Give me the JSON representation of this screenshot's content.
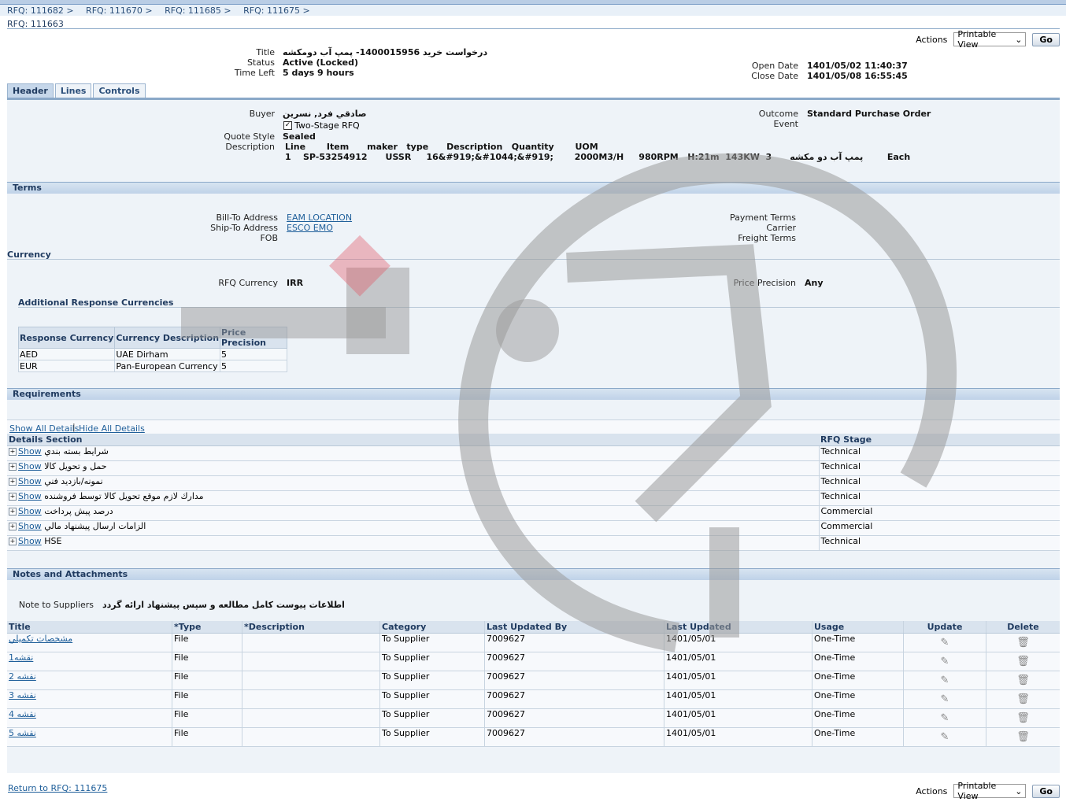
{
  "breadcrumbs": [
    "RFQ: 111682",
    "RFQ: 111670",
    "RFQ: 111685",
    "RFQ: 111675"
  ],
  "page_title": "RFQ: 111663",
  "actions": {
    "label": "Actions",
    "selected": "Printable View",
    "go": "Go"
  },
  "summary": {
    "title_label": "Title",
    "title_value": "درخواست خريد 1400015956- پمپ آب دومكشه",
    "status_label": "Status",
    "status_value": "Active (Locked)",
    "time_left_label": "Time Left",
    "time_left_value": "5 days 9 hours",
    "open_date_label": "Open Date",
    "open_date_value": "1401/05/02 11:40:37",
    "close_date_label": "Close Date",
    "close_date_value": "1401/05/08 16:55:45"
  },
  "tabs": [
    "Header",
    "Lines",
    "Controls"
  ],
  "header": {
    "buyer_label": "Buyer",
    "buyer_value": "صادقي فرد, نسرين",
    "two_stage_label": "Two-Stage RFQ",
    "quote_style_label": "Quote Style",
    "quote_style_value": "Sealed",
    "description_label": "Description",
    "desc_line1": "Line       Item      maker   type      Description   Quantity       UOM",
    "desc_line2": "1    SP-53254912      USSR     16&#919;&#1044;&#919;       2000M3/H     980RPM   H:21m  143KW  3      پمپ آب دو مكشه        Each",
    "outcome_label": "Outcome",
    "outcome_value": "Standard Purchase Order",
    "event_label": "Event"
  },
  "terms": {
    "section": "Terms",
    "bill_to_label": "Bill-To Address",
    "bill_to_value": "EAM LOCATION",
    "ship_to_label": "Ship-To Address",
    "ship_to_value": "ESCO EMO",
    "fob_label": "FOB",
    "payment_terms_label": "Payment Terms",
    "carrier_label": "Carrier",
    "freight_terms_label": "Freight Terms"
  },
  "currency": {
    "section": "Currency",
    "rfq_currency_label": "RFQ Currency",
    "rfq_currency_value": "IRR",
    "price_precision_label": "Price Precision",
    "price_precision_value": "Any",
    "additional_heading": "Additional Response Currencies",
    "columns": [
      "Response Currency",
      "Currency Description",
      "Price Precision"
    ],
    "rows": [
      [
        "AED",
        "UAE Dirham",
        "5"
      ],
      [
        "EUR",
        "Pan-European Currency",
        "5"
      ]
    ]
  },
  "requirements": {
    "section": "Requirements",
    "show_all": "Show All Details",
    "hide_all": "Hide All Details",
    "columns": [
      "Details Section",
      "RFQ Stage"
    ],
    "show_label": "Show",
    "rows": [
      {
        "name": "شرايط بسته بندي",
        "stage": "Technical"
      },
      {
        "name": "حمل و تحويل كالا",
        "stage": "Technical"
      },
      {
        "name": "نمونه/بازديد فني",
        "stage": "Technical"
      },
      {
        "name": "مدارك لازم موقع تحويل كالا توسط فروشنده",
        "stage": "Technical"
      },
      {
        "name": "درصد پيش پرداخت",
        "stage": "Commercial"
      },
      {
        "name": "الزامات ارسال پيشنهاد مالي",
        "stage": "Commercial"
      },
      {
        "name": "HSE",
        "stage": "Technical"
      }
    ]
  },
  "notes": {
    "section": "Notes and Attachments",
    "note_label": "Note to Suppliers",
    "note_value": "اطلاعات پيوست كامل مطالعه و سپس پيشنهاد ارائه گردد",
    "columns": [
      "Title",
      "*Type",
      "*Description",
      "Category",
      "Last Updated By",
      "Last Updated",
      "Usage",
      "Update",
      "Delete"
    ],
    "rows": [
      [
        "مشخصات تكميلي",
        "File",
        "",
        "To Supplier",
        "7009627",
        "1401/05/01",
        "One-Time"
      ],
      [
        "نقشه1",
        "File",
        "",
        "To Supplier",
        "7009627",
        "1401/05/01",
        "One-Time"
      ],
      [
        "نقشه 2",
        "File",
        "",
        "To Supplier",
        "7009627",
        "1401/05/01",
        "One-Time"
      ],
      [
        "نقشه 3",
        "File",
        "",
        "To Supplier",
        "7009627",
        "1401/05/01",
        "One-Time"
      ],
      [
        "نقشه 4",
        "File",
        "",
        "To Supplier",
        "7009627",
        "1401/05/01",
        "One-Time"
      ],
      [
        "نقشه 5",
        "File",
        "",
        "To Supplier",
        "7009627",
        "1401/05/01",
        "One-Time"
      ]
    ]
  },
  "footer": {
    "return_link": "Return to RFQ: 111675"
  },
  "icons": {
    "update": "pencil-icon",
    "delete": "trash-icon",
    "expand": "plus-icon"
  }
}
